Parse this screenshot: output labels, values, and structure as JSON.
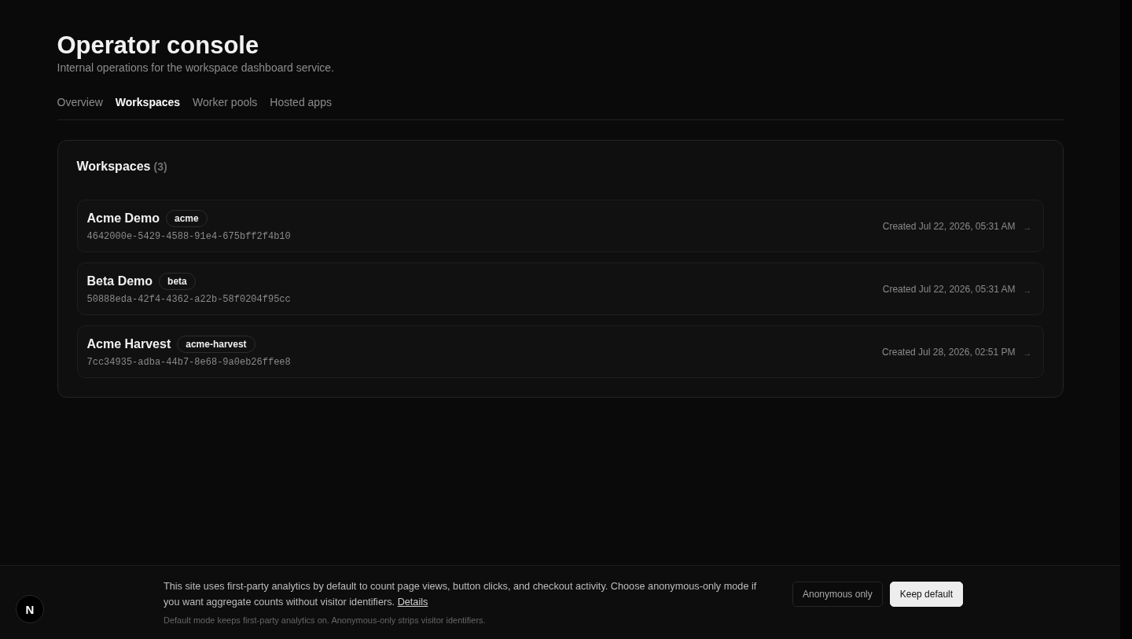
{
  "header": {
    "title": "Operator console",
    "subtitle": "Internal operations for the workspace dashboard service."
  },
  "tabs": [
    {
      "label": "Overview",
      "selected": false
    },
    {
      "label": "Workspaces",
      "selected": true
    },
    {
      "label": "Worker pools",
      "selected": false
    },
    {
      "label": "Hosted apps",
      "selected": false
    }
  ],
  "workspaces": {
    "title": "Workspaces",
    "count": "(3)",
    "rows": [
      {
        "name": "Acme Demo",
        "slug": "acme",
        "id": "4642000e-5429-4588-91e4-675bff2f4b10",
        "created": "Created Jul 22, 2026, 05:31 AM",
        "arrow": "→"
      },
      {
        "name": "Beta Demo",
        "slug": "beta",
        "id": "50888eda-42f4-4362-a22b-58f0204f95cc",
        "created": "Created Jul 22, 2026, 05:31 AM",
        "arrow": "→"
      },
      {
        "name": "Acme Harvest",
        "slug": "acme-harvest",
        "id": "7cc34935-adba-44b7-8e68-9a0eb26ffee8",
        "created": "Created Jul 28, 2026, 02:51 PM",
        "arrow": "→"
      }
    ]
  },
  "consent_banner": {
    "text": "This site uses first-party analytics by default to count page views, button clicks, and checkout activity. Choose anonymous-only mode if you want aggregate counts without visitor identifiers.",
    "link": "Details",
    "note": "Default mode keeps first-party analytics on. Anonymous-only strips visitor identifiers.",
    "buttons": [
      {
        "label": "Anonymous only",
        "kind": "secondary"
      },
      {
        "label": "Keep default",
        "kind": "primary"
      }
    ]
  },
  "dev_badge": {
    "label": "N"
  }
}
